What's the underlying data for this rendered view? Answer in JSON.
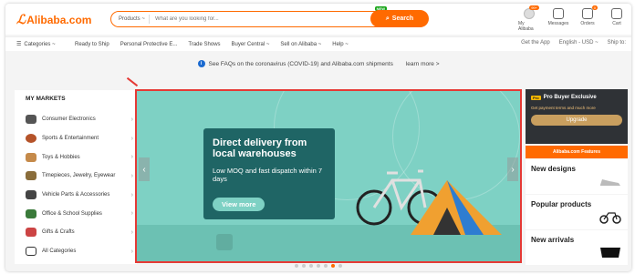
{
  "header": {
    "logo_text": "Alibaba.com",
    "search_category": "Products ~",
    "search_placeholder": "What are you looking for...",
    "search_button": "Search",
    "new_badge": "NEW",
    "icons": [
      {
        "name": "my-alibaba",
        "label": "My Alibaba",
        "badge": "99+"
      },
      {
        "name": "messages",
        "label": "Messages",
        "badge": ""
      },
      {
        "name": "orders",
        "label": "Orders",
        "badge": "0"
      },
      {
        "name": "cart",
        "label": "Cart",
        "badge": ""
      }
    ]
  },
  "nav": {
    "categories": "Categories ~",
    "items": [
      "Ready to Ship",
      "Personal Protective E...",
      "Trade Shows",
      "Buyer Central ~",
      "Sell on Alibaba ~",
      "Help ~"
    ],
    "get_app": "Get the App",
    "language": "English - USD ~",
    "ship_to": "Ship to:"
  },
  "notice": {
    "text": "See FAQs on the coronavirus (COVID-19) and Alibaba.com shipments",
    "learn_more": "learn more >"
  },
  "markets": {
    "title": "MY MARKETS",
    "items": [
      "Consumer Electronics",
      "Sports & Entertainment",
      "Toys & Hobbies",
      "Timepieces, Jewelry, Eyewear",
      "Vehicle Parts & Accessories",
      "Office & School Supplies",
      "Gifts & Crafts",
      "All Categories"
    ]
  },
  "banner": {
    "headline": "Direct delivery from local warehouses",
    "subtext": "Low MOQ and fast dispatch within 7 days",
    "button": "View more",
    "carousel": {
      "count": 7,
      "active": 5
    }
  },
  "right": {
    "pro_title": "Pro Buyer Exclusive",
    "pro_tag": "Pro",
    "pro_desc": "Get payment terms and much more",
    "upgrade": "Upgrade",
    "features": "Alibaba.com Features",
    "cards": [
      "New designs",
      "Popular products",
      "New arrivals"
    ]
  },
  "colors": {
    "accent": "#ff6a00",
    "banner_bg": "#7ed1c4",
    "card_bg": "#1f6565",
    "highlight": "#e53935"
  }
}
